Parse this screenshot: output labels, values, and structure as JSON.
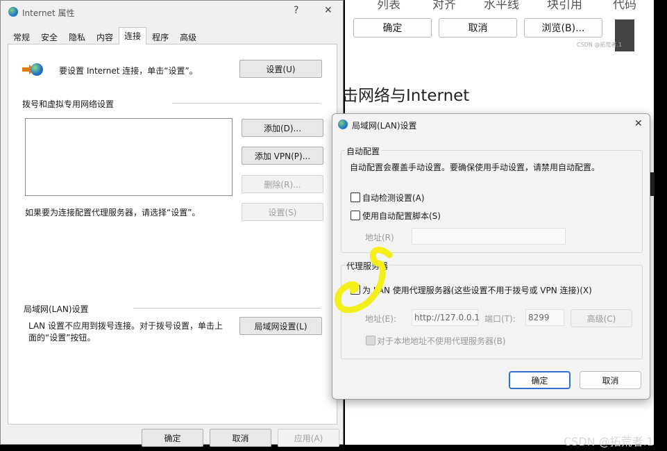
{
  "background": {
    "top_labels": [
      "列表",
      "对齐",
      "水平线",
      "块引用",
      "代码"
    ],
    "buttons": [
      "确定",
      "取消",
      "浏览(B)..."
    ],
    "small_text": "CSDN @拓荒者.1",
    "heading": "击网络与Internet"
  },
  "ie": {
    "title": "Internet 属性",
    "help": "?",
    "close": "✕",
    "tabs": [
      "常规",
      "安全",
      "隐私",
      "内容",
      "连接",
      "程序",
      "高级"
    ],
    "setup_text": "要设置 Internet 连接，单击“设置”。",
    "setup_button": "设置(U)",
    "dialup_heading": "拨号和虚拟专用网络设置",
    "add_button": "添加(D)...",
    "add_vpn_button": "添加 VPN(P)...",
    "remove_button": "删除(R)...",
    "proxy_hint": "如果要为连接配置代理服务器，请选择“设置”。",
    "settings_button": "设置(S)",
    "lan_heading": "局域网(LAN)设置",
    "lan_text": "LAN 设置不应用到拨号连接。对于拨号设置，单击上面的“设置”按钮。",
    "lan_button": "局域网设置(L)",
    "ok": "确定",
    "cancel": "取消",
    "apply": "应用(A)"
  },
  "lan": {
    "title": "局域网(LAN)设置",
    "close": "✕",
    "auto_config": {
      "title": "自动配置",
      "desc": "自动配置会覆盖手动设置。要确保使用手动设置，请禁用自动配置。",
      "auto_detect": "自动检测设置(A)",
      "use_script": "使用自动配置脚本(S)",
      "address_label": "地址(R)"
    },
    "proxy": {
      "title": "代理服务器",
      "use_proxy": "为 LAN 使用代理服务器(这些设置不用于拨号或 VPN 连接)(X)",
      "address_label": "地址(E):",
      "address_value": "http://127.0.0.1",
      "port_label": "端口(T):",
      "port_value": "8299",
      "advanced": "高级(C)",
      "bypass_local": "对于本地地址不使用代理服务器(B)"
    },
    "ok": "确定",
    "cancel": "取消"
  },
  "watermark": "CSDN @拓荒者.1",
  "annotation_color": "#f4ee1a"
}
